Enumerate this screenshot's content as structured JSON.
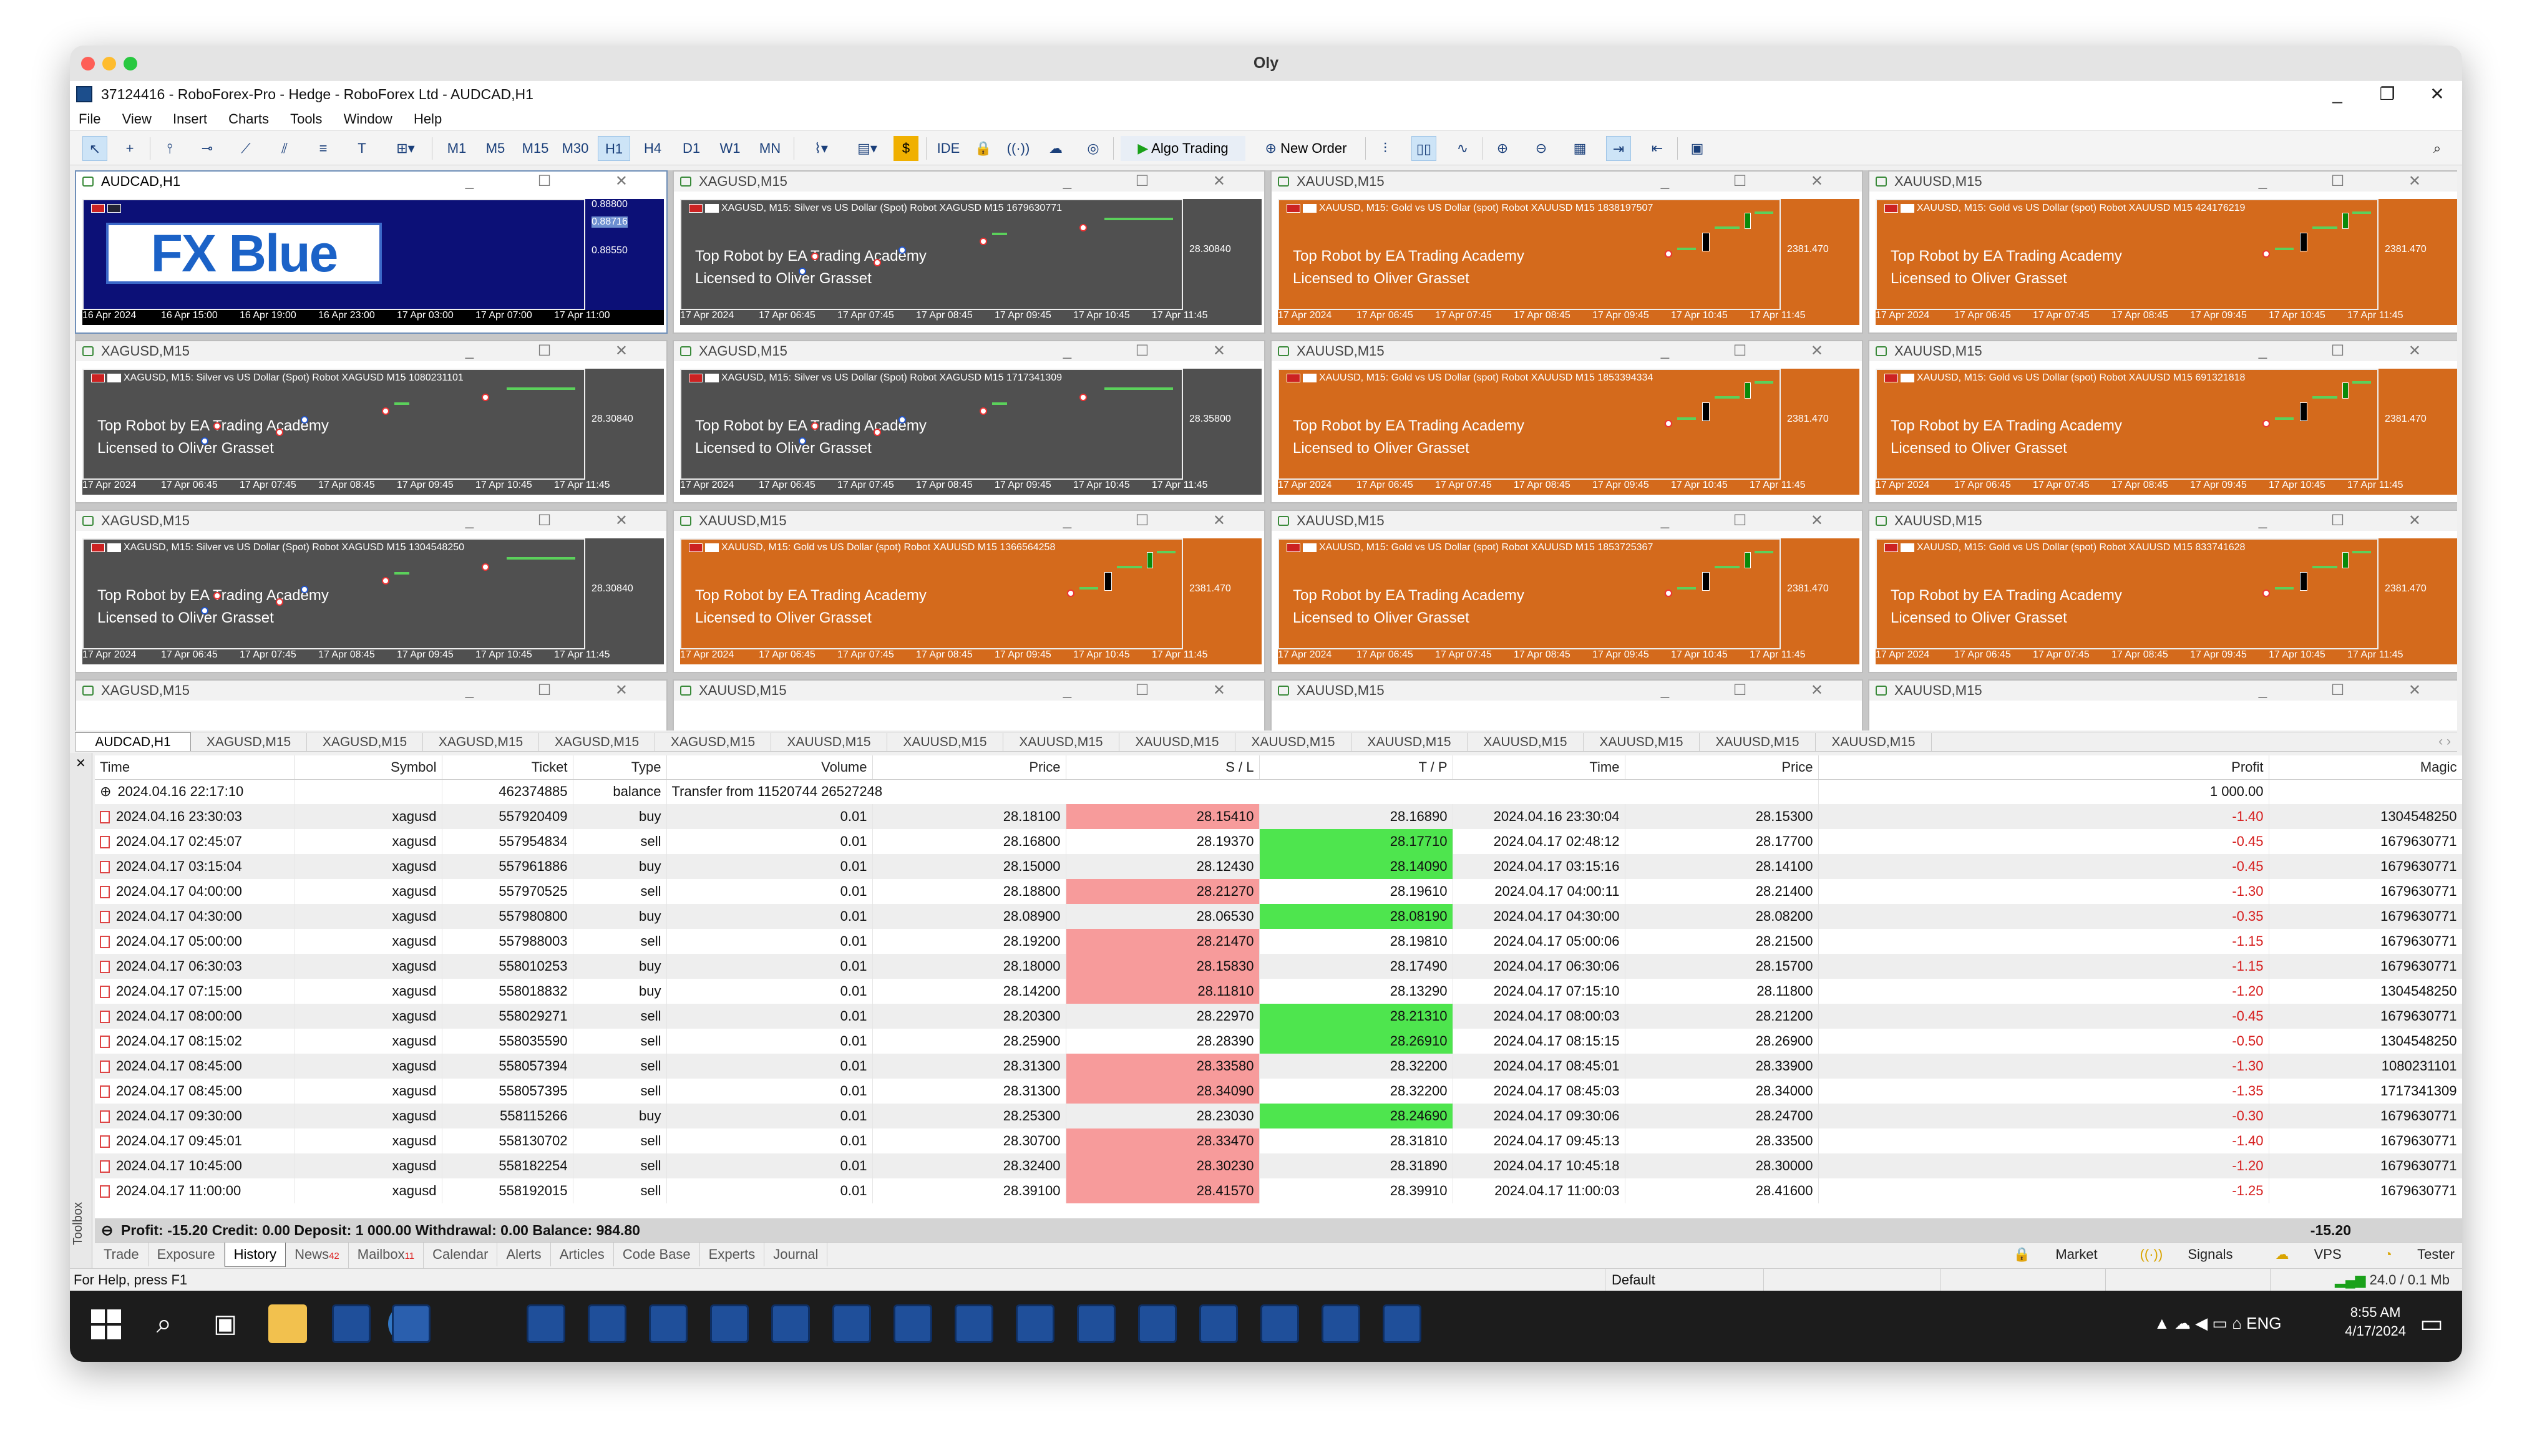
{
  "mac_title": "Oly",
  "window": {
    "title": "37124416 - RoboForex-Pro - Hedge - RoboForex Ltd - AUDCAD,H1",
    "controls": [
      "_",
      "❐",
      "✕"
    ]
  },
  "menu": [
    "File",
    "View",
    "Insert",
    "Charts",
    "Tools",
    "Window",
    "Help"
  ],
  "toolbar": {
    "timeframes": [
      "M1",
      "M5",
      "M15",
      "M30",
      "H1",
      "H4",
      "D1",
      "W1",
      "MN"
    ],
    "selected_timeframe": "H1",
    "ide": "IDE",
    "algo_trading": "Algo Trading",
    "new_order": "New Order"
  },
  "charts": [
    {
      "title": "AUDCAD,H1",
      "style": "fxblue",
      "logo": "FX Blue",
      "prices": [
        "0.88800",
        "0.88716",
        "0.88550"
      ],
      "xlabels": [
        "16 Apr 2024",
        "16 Apr 15:00",
        "16 Apr 19:00",
        "16 Apr 23:00",
        "17 Apr 03:00",
        "17 Apr 07:00",
        "17 Apr 11:00"
      ]
    },
    {
      "title": "XAGUSD,M15",
      "style": "grey",
      "info": "XAGUSD, M15:  Silver vs US Dollar (Spot)     Robot XAGUSD M15 1679630771",
      "price": "28.30840",
      "line1": "Top Robot by EA Trading Academy",
      "line2": "Licensed to Oliver Grasset",
      "xlabels": [
        "17 Apr 2024",
        "17 Apr 06:45",
        "17 Apr 07:45",
        "17 Apr 08:45",
        "17 Apr 09:45",
        "17 Apr 10:45",
        "17 Apr 11:45"
      ]
    },
    {
      "title": "XAUUSD,M15",
      "style": "orange",
      "info": "XAUUSD, M15:  Gold vs US Dollar (spot)     Robot XAUUSD M15 1838197507",
      "price": "2381.470",
      "line1": "Top Robot by EA Trading Academy",
      "line2": "Licensed to Oliver Grasset",
      "xlabels": [
        "17 Apr 2024",
        "17 Apr 06:45",
        "17 Apr 07:45",
        "17 Apr 08:45",
        "17 Apr 09:45",
        "17 Apr 10:45",
        "17 Apr 11:45"
      ]
    },
    {
      "title": "XAUUSD,M15",
      "style": "orange",
      "info": "XAUUSD, M15:  Gold vs US Dollar (spot)     Robot XAUUSD M15 424176219",
      "price": "2381.470",
      "line1": "Top Robot by EA Trading Academy",
      "line2": "Licensed to Oliver Grasset",
      "xlabels": [
        "17 Apr 2024",
        "17 Apr 06:45",
        "17 Apr 07:45",
        "17 Apr 08:45",
        "17 Apr 09:45",
        "17 Apr 10:45",
        "17 Apr 11:45"
      ]
    },
    {
      "title": "XAGUSD,M15",
      "style": "grey",
      "info": "XAGUSD, M15:  Silver vs US Dollar (Spot)     Robot XAGUSD M15 1080231101",
      "price": "28.30840",
      "line1": "Top Robot by EA Trading Academy",
      "line2": "Licensed to Oliver Grasset",
      "xlabels": [
        "17 Apr 2024",
        "17 Apr 06:45",
        "17 Apr 07:45",
        "17 Apr 08:45",
        "17 Apr 09:45",
        "17 Apr 10:45",
        "17 Apr 11:45"
      ]
    },
    {
      "title": "XAGUSD,M15",
      "style": "grey",
      "info": "XAGUSD, M15:  Silver vs US Dollar (Spot)     Robot XAGUSD M15 1717341309",
      "price": "28.35800",
      "line1": "Top Robot by EA Trading Academy",
      "line2": "Licensed to Oliver Grasset",
      "xlabels": [
        "17 Apr 2024",
        "17 Apr 06:45",
        "17 Apr 07:45",
        "17 Apr 08:45",
        "17 Apr 09:45",
        "17 Apr 10:45",
        "17 Apr 11:45"
      ]
    },
    {
      "title": "XAUUSD,M15",
      "style": "orange",
      "info": "XAUUSD, M15:  Gold vs US Dollar (spot)     Robot XAUUSD M15 1853394334",
      "price": "2381.470",
      "line1": "Top Robot by EA Trading Academy",
      "line2": "Licensed to Oliver Grasset",
      "xlabels": [
        "17 Apr 2024",
        "17 Apr 06:45",
        "17 Apr 07:45",
        "17 Apr 08:45",
        "17 Apr 09:45",
        "17 Apr 10:45",
        "17 Apr 11:45"
      ]
    },
    {
      "title": "XAUUSD,M15",
      "style": "orange",
      "info": "XAUUSD, M15:  Gold vs US Dollar (spot)     Robot XAUUSD M15 691321818",
      "price": "2381.470",
      "line1": "Top Robot by EA Trading Academy",
      "line2": "Licensed to Oliver Grasset",
      "xlabels": [
        "17 Apr 2024",
        "17 Apr 06:45",
        "17 Apr 07:45",
        "17 Apr 08:45",
        "17 Apr 09:45",
        "17 Apr 10:45",
        "17 Apr 11:45"
      ]
    },
    {
      "title": "XAGUSD,M15",
      "style": "grey",
      "info": "XAGUSD, M15:  Silver vs US Dollar (Spot)     Robot XAGUSD M15 1304548250",
      "price": "28.30840",
      "line1": "Top Robot by EA Trading Academy",
      "line2": "Licensed to Oliver Grasset",
      "xlabels": [
        "17 Apr 2024",
        "17 Apr 06:45",
        "17 Apr 07:45",
        "17 Apr 08:45",
        "17 Apr 09:45",
        "17 Apr 10:45",
        "17 Apr 11:45"
      ]
    },
    {
      "title": "XAUUSD,M15",
      "style": "orange",
      "info": "XAUUSD, M15:  Gold vs US Dollar (spot)     Robot XAUUSD M15 1366564258",
      "price": "2381.470",
      "line1": "Top Robot by EA Trading Academy",
      "line2": "Licensed to Oliver Grasset",
      "xlabels": [
        "17 Apr 2024",
        "17 Apr 06:45",
        "17 Apr 07:45",
        "17 Apr 08:45",
        "17 Apr 09:45",
        "17 Apr 10:45",
        "17 Apr 11:45"
      ]
    },
    {
      "title": "XAUUSD,M15",
      "style": "orange",
      "info": "XAUUSD, M15:  Gold vs US Dollar (spot)     Robot XAUUSD M15 1853725367",
      "price": "2381.470",
      "line1": "Top Robot by EA Trading Academy",
      "line2": "Licensed to Oliver Grasset",
      "xlabels": [
        "17 Apr 2024",
        "17 Apr 06:45",
        "17 Apr 07:45",
        "17 Apr 08:45",
        "17 Apr 09:45",
        "17 Apr 10:45",
        "17 Apr 11:45"
      ]
    },
    {
      "title": "XAUUSD,M15",
      "style": "orange",
      "info": "XAUUSD, M15:  Gold vs US Dollar (spot)     Robot XAUUSD M15 833741628",
      "price": "2381.470",
      "line1": "Top Robot by EA Trading Academy",
      "line2": "Licensed to Oliver Grasset",
      "xlabels": [
        "17 Apr 2024",
        "17 Apr 06:45",
        "17 Apr 07:45",
        "17 Apr 08:45",
        "17 Apr 09:45",
        "17 Apr 10:45",
        "17 Apr 11:45"
      ]
    },
    {
      "title": "XAGUSD,M15",
      "style": "blank"
    },
    {
      "title": "XAUUSD,M15",
      "style": "blank"
    },
    {
      "title": "XAUUSD,M15",
      "style": "blank"
    },
    {
      "title": "XAUUSD,M15",
      "style": "blank"
    }
  ],
  "chart_tabs": [
    "AUDCAD,H1",
    "XAGUSD,M15",
    "XAGUSD,M15",
    "XAGUSD,M15",
    "XAGUSD,M15",
    "XAGUSD,M15",
    "XAUUSD,M15",
    "XAUUSD,M15",
    "XAUUSD,M15",
    "XAUUSD,M15",
    "XAUUSD,M15",
    "XAUUSD,M15",
    "XAUUSD,M15",
    "XAUUSD,M15",
    "XAUUSD,M15",
    "XAUUSD,M15"
  ],
  "history": {
    "headers": [
      "Time",
      "Symbol",
      "Ticket",
      "Type",
      "Volume",
      "Price",
      "S / L",
      "T / P",
      "Time",
      "Price",
      "Profit",
      "Magic"
    ],
    "balance_row": {
      "time": "2024.04.16 22:17:10",
      "ticket": "462374885",
      "type": "balance",
      "comment": "Transfer from 11520744 26527248",
      "profit": "1 000.00"
    },
    "rows": [
      [
        "2024.04.16 23:30:03",
        "xagusd",
        "557920409",
        "buy",
        "0.01",
        "28.18100",
        "28.15410",
        "28.16890",
        "2024.04.16 23:30:04",
        "28.15300",
        "-1.40",
        "1304548250",
        "red",
        ""
      ],
      [
        "2024.04.17 02:45:07",
        "xagusd",
        "557954834",
        "sell",
        "0.01",
        "28.16800",
        "28.19370",
        "28.17710",
        "2024.04.17 02:48:12",
        "28.17700",
        "-0.45",
        "1679630771",
        "",
        "green"
      ],
      [
        "2024.04.17 03:15:04",
        "xagusd",
        "557961886",
        "buy",
        "0.01",
        "28.15000",
        "28.12430",
        "28.14090",
        "2024.04.17 03:15:16",
        "28.14100",
        "-0.45",
        "1679630771",
        "",
        "green"
      ],
      [
        "2024.04.17 04:00:00",
        "xagusd",
        "557970525",
        "sell",
        "0.01",
        "28.18800",
        "28.21270",
        "28.19610",
        "2024.04.17 04:00:11",
        "28.21400",
        "-1.30",
        "1679630771",
        "red",
        ""
      ],
      [
        "2024.04.17 04:30:00",
        "xagusd",
        "557980800",
        "buy",
        "0.01",
        "28.08900",
        "28.06530",
        "28.08190",
        "2024.04.17 04:30:00",
        "28.08200",
        "-0.35",
        "1679630771",
        "",
        "green"
      ],
      [
        "2024.04.17 05:00:00",
        "xagusd",
        "557988003",
        "sell",
        "0.01",
        "28.19200",
        "28.21470",
        "28.19810",
        "2024.04.17 05:00:06",
        "28.21500",
        "-1.15",
        "1679630771",
        "red",
        ""
      ],
      [
        "2024.04.17 06:30:03",
        "xagusd",
        "558010253",
        "buy",
        "0.01",
        "28.18000",
        "28.15830",
        "28.17490",
        "2024.04.17 06:30:06",
        "28.15700",
        "-1.15",
        "1679630771",
        "red",
        ""
      ],
      [
        "2024.04.17 07:15:00",
        "xagusd",
        "558018832",
        "buy",
        "0.01",
        "28.14200",
        "28.11810",
        "28.13290",
        "2024.04.17 07:15:10",
        "28.11800",
        "-1.20",
        "1304548250",
        "red",
        ""
      ],
      [
        "2024.04.17 08:00:00",
        "xagusd",
        "558029271",
        "sell",
        "0.01",
        "28.20300",
        "28.22970",
        "28.21310",
        "2024.04.17 08:00:03",
        "28.21200",
        "-0.45",
        "1679630771",
        "",
        "green"
      ],
      [
        "2024.04.17 08:15:02",
        "xagusd",
        "558035590",
        "sell",
        "0.01",
        "28.25900",
        "28.28390",
        "28.26910",
        "2024.04.17 08:15:15",
        "28.26900",
        "-0.50",
        "1304548250",
        "",
        "green"
      ],
      [
        "2024.04.17 08:45:00",
        "xagusd",
        "558057394",
        "sell",
        "0.01",
        "28.31300",
        "28.33580",
        "28.32200",
        "2024.04.17 08:45:01",
        "28.33900",
        "-1.30",
        "1080231101",
        "red",
        ""
      ],
      [
        "2024.04.17 08:45:00",
        "xagusd",
        "558057395",
        "sell",
        "0.01",
        "28.31300",
        "28.34090",
        "28.32200",
        "2024.04.17 08:45:03",
        "28.34000",
        "-1.35",
        "1717341309",
        "red",
        ""
      ],
      [
        "2024.04.17 09:30:00",
        "xagusd",
        "558115266",
        "buy",
        "0.01",
        "28.25300",
        "28.23030",
        "28.24690",
        "2024.04.17 09:30:06",
        "28.24700",
        "-0.30",
        "1679630771",
        "",
        "green"
      ],
      [
        "2024.04.17 09:45:01",
        "xagusd",
        "558130702",
        "sell",
        "0.01",
        "28.30700",
        "28.33470",
        "28.31810",
        "2024.04.17 09:45:13",
        "28.33500",
        "-1.40",
        "1679630771",
        "red",
        ""
      ],
      [
        "2024.04.17 10:45:00",
        "xagusd",
        "558182254",
        "sell",
        "0.01",
        "28.32400",
        "28.30230",
        "28.31890",
        "2024.04.17 10:45:18",
        "28.30000",
        "-1.20",
        "1679630771",
        "red",
        ""
      ],
      [
        "2024.04.17 11:00:00",
        "xagusd",
        "558192015",
        "sell",
        "0.01",
        "28.39100",
        "28.41570",
        "28.39910",
        "2024.04.17 11:00:03",
        "28.41600",
        "-1.25",
        "1679630771",
        "red",
        ""
      ]
    ],
    "summary": "Profit: -15.20  Credit: 0.00  Deposit: 1 000.00  Withdrawal: 0.00  Balance: 984.80",
    "summary_profit": "-15.20"
  },
  "toolbox_label": "Toolbox",
  "bottom_tabs": [
    {
      "label": "Trade"
    },
    {
      "label": "Exposure"
    },
    {
      "label": "History"
    },
    {
      "label": "News",
      "badge": "42"
    },
    {
      "label": "Mailbox",
      "badge": "11"
    },
    {
      "label": "Calendar"
    },
    {
      "label": "Alerts"
    },
    {
      "label": "Articles"
    },
    {
      "label": "Code Base"
    },
    {
      "label": "Experts"
    },
    {
      "label": "Journal"
    }
  ],
  "bottom_right": [
    "Market",
    "Signals",
    "VPS",
    "Tester"
  ],
  "status": {
    "help": "For Help, press F1",
    "profile": "Default",
    "traffic": "24.0 / 0.1 Mb"
  },
  "taskbar": {
    "time": "8:55 AM",
    "date": "4/17/2024",
    "lang": "ENG"
  }
}
